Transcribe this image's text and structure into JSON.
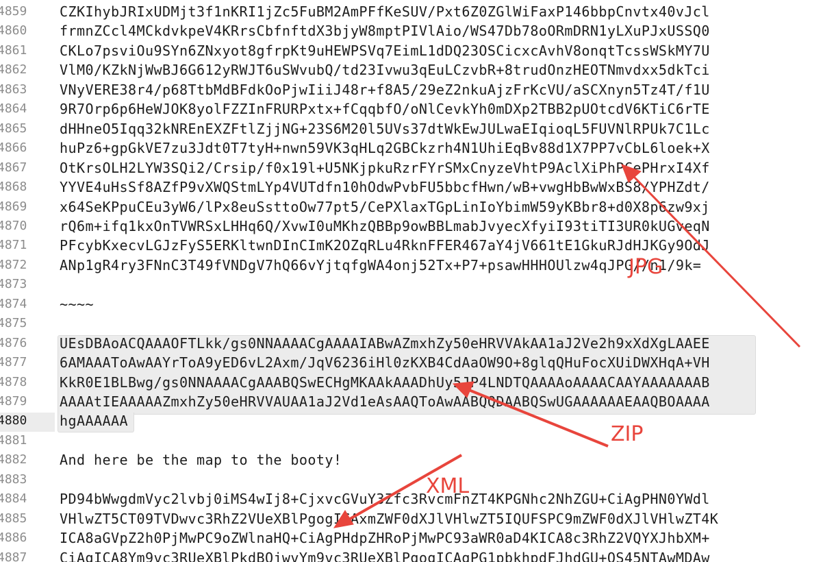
{
  "editor": {
    "accent_color": "#e8453c",
    "lines": [
      {
        "num": "4859",
        "text": "CZKIhybJRIxUDMjt3f1nKRI1jZc5FuBM2AmPFfKeSUV/Pxt6Z0ZGlWiFaxP146bbpCnvtx40vJcl"
      },
      {
        "num": "4860",
        "text": "frmnZCcl4MCkdvkpeV4KRrsCbfnftdX3bjyW8mptPIVlAio/WS47Db78oORmDRN1yLXuPJxUSSQ0"
      },
      {
        "num": "4861",
        "text": "CKLo7psviOu9SYn6ZNxyot8gfrpKt9uHEWPSVq7EimL1dDQ23OSCicxcAvhV8onqtTcssWSkMY7U"
      },
      {
        "num": "4862",
        "text": "VlM0/KZkNjWwBJ6G612yRWJT6uSWvubQ/td23Ivwu3qEuLCzvbR+8trudOnzHEOTNmvdxx5dkTci"
      },
      {
        "num": "4863",
        "text": "VNyVERE38r4/p68TtbMdBFdkOoPjwIiiJ48r+f8A5/29eZ2nkuAjzFrKcVU/aSCXnyn5Tz4T/f1U"
      },
      {
        "num": "4864",
        "text": "9R7Orp6p6HeWJOK8yolFZZInFRURPxtx+fCqqbfO/oNlCevkYh0mDXp2TBB2pUOtcdV6KTiC6rTE"
      },
      {
        "num": "4865",
        "text": "dHHneO5Iqq32kNREnEXZFtlZjjNG+23S6M20l5UVs37dtWkEwJULwaEIqioqL5FUVNlRPUk7C1Lc"
      },
      {
        "num": "4866",
        "text": "huPz6+gpGkVE7zu3Jdt0T7tyH+nwn59VK3qHLq2GBCkzrh4N1UhiEqBv88d1X7PP7vCbL6loek+X"
      },
      {
        "num": "4867",
        "text": "OtKrsOLH2LYW3SQi2/Crsip/f0x19l+U5NKjpkuRzrFYrSMxCnyzeVhtP9AclXiPhPCePHrxI4Xf"
      },
      {
        "num": "4868",
        "text": "YYVE4uHsSf8AZfP9vXWQStmLYp4VUTdfn10hOdwPvbFU5bbcfHwn/wB+vwgHbBwWxBS8/YPHZdt/"
      },
      {
        "num": "4869",
        "text": "x64SeKPpuCEu3yW6/lPx8euSsttoOw77pt5/CePXlaxTGpLinIoYbimW59yKBbr8+d0X8p6zw9xj"
      },
      {
        "num": "4870",
        "text": "rQ6m+ifq1kxOnTVWRSxLHHq6Q/XvwI0uMKhzQBBp9owBBLmabJvyecXfyiI93tiTI3UR0kUGveqN"
      },
      {
        "num": "4871",
        "text": "PFcybKxecvLGJzFyS5ERKltwnDInCImK2OZqRLu4RknFFER467aY4jV661tE1GkuRJdHJKGy9OdJ"
      },
      {
        "num": "4872",
        "text": "ANp1gR4ry3FNnC3T49fVNDgV7hQ66vYjtqfgWA4onj52Tx+P7+psawHHHOUlzw4qJPG//n1/9k="
      },
      {
        "num": "4873",
        "text": ""
      },
      {
        "num": "4874",
        "text": "~~~~"
      },
      {
        "num": "4875",
        "text": ""
      },
      {
        "num": "4876",
        "text": "UEsDBAoACQAAAOFTLkk/gs0NNAAAACgAAAAIABwAZmxhZy50eHRVVAkAA1aJ2Ve2h9xXdXgLAAEE"
      },
      {
        "num": "4877",
        "text": "6AMAAAToAwAAYrToA9yED6vL2Axm/JqV6236iHl0zKXB4CdAaOW9O+8glqQHuFocXUiDWXHqA+VH"
      },
      {
        "num": "4878",
        "text": "KkR0E1BLBwg/gs0NNAAAACgAAABQSwECHgMKAAkAAADhUy5JP4LNDTQAAAAoAAAACAAYAAAAAAAB"
      },
      {
        "num": "4879",
        "text": "AAAAtIEAAAAAZmxhZy50eHRVVAUAA1aJ2Vd1eAsAAQToAwAABQQDAABQSwUGAAAAAAEAAQBOAAAA"
      },
      {
        "num": "4880",
        "text": "hgAAAAAA"
      },
      {
        "num": "4881",
        "text": ""
      },
      {
        "num": "4882",
        "text": "And here be the map to the booty!"
      },
      {
        "num": "4883",
        "text": ""
      },
      {
        "num": "4884",
        "text": "PD94bWwgdmVyc2lvbj0iMS4wIj8+CjxvcGVuY3Zfc3RvcmFnZT4KPGNhc2NhZGU+CiAgPHN0YWdl"
      },
      {
        "num": "4885",
        "text": "VHlwZT5CT09TVDwvc3RhZ2VUeXBlPgogICAxmZWF0dXJlVHlwZT5IQUFSPC9mZWF0dXJlVHlwZT4K"
      },
      {
        "num": "4886",
        "text": "ICA8aGVpZ2h0PjMwPC9oZWlnaHQ+CiAgPHdpZHRoPjMwPC93aWR0aD4KICA8c3RhZ2VQYXJhbXM+"
      },
      {
        "num": "4887",
        "text": "CiAgICA8Ym9vc3RUeXBlPkdBQjwvYm9vc3RUeXBlPgogICAgPG1pbkhpdFJhdGU+OS45NTAwMDAw"
      }
    ]
  },
  "annotations": {
    "jpg_label": "JPG",
    "zip_label": "ZIP",
    "xml_label": "XML"
  }
}
